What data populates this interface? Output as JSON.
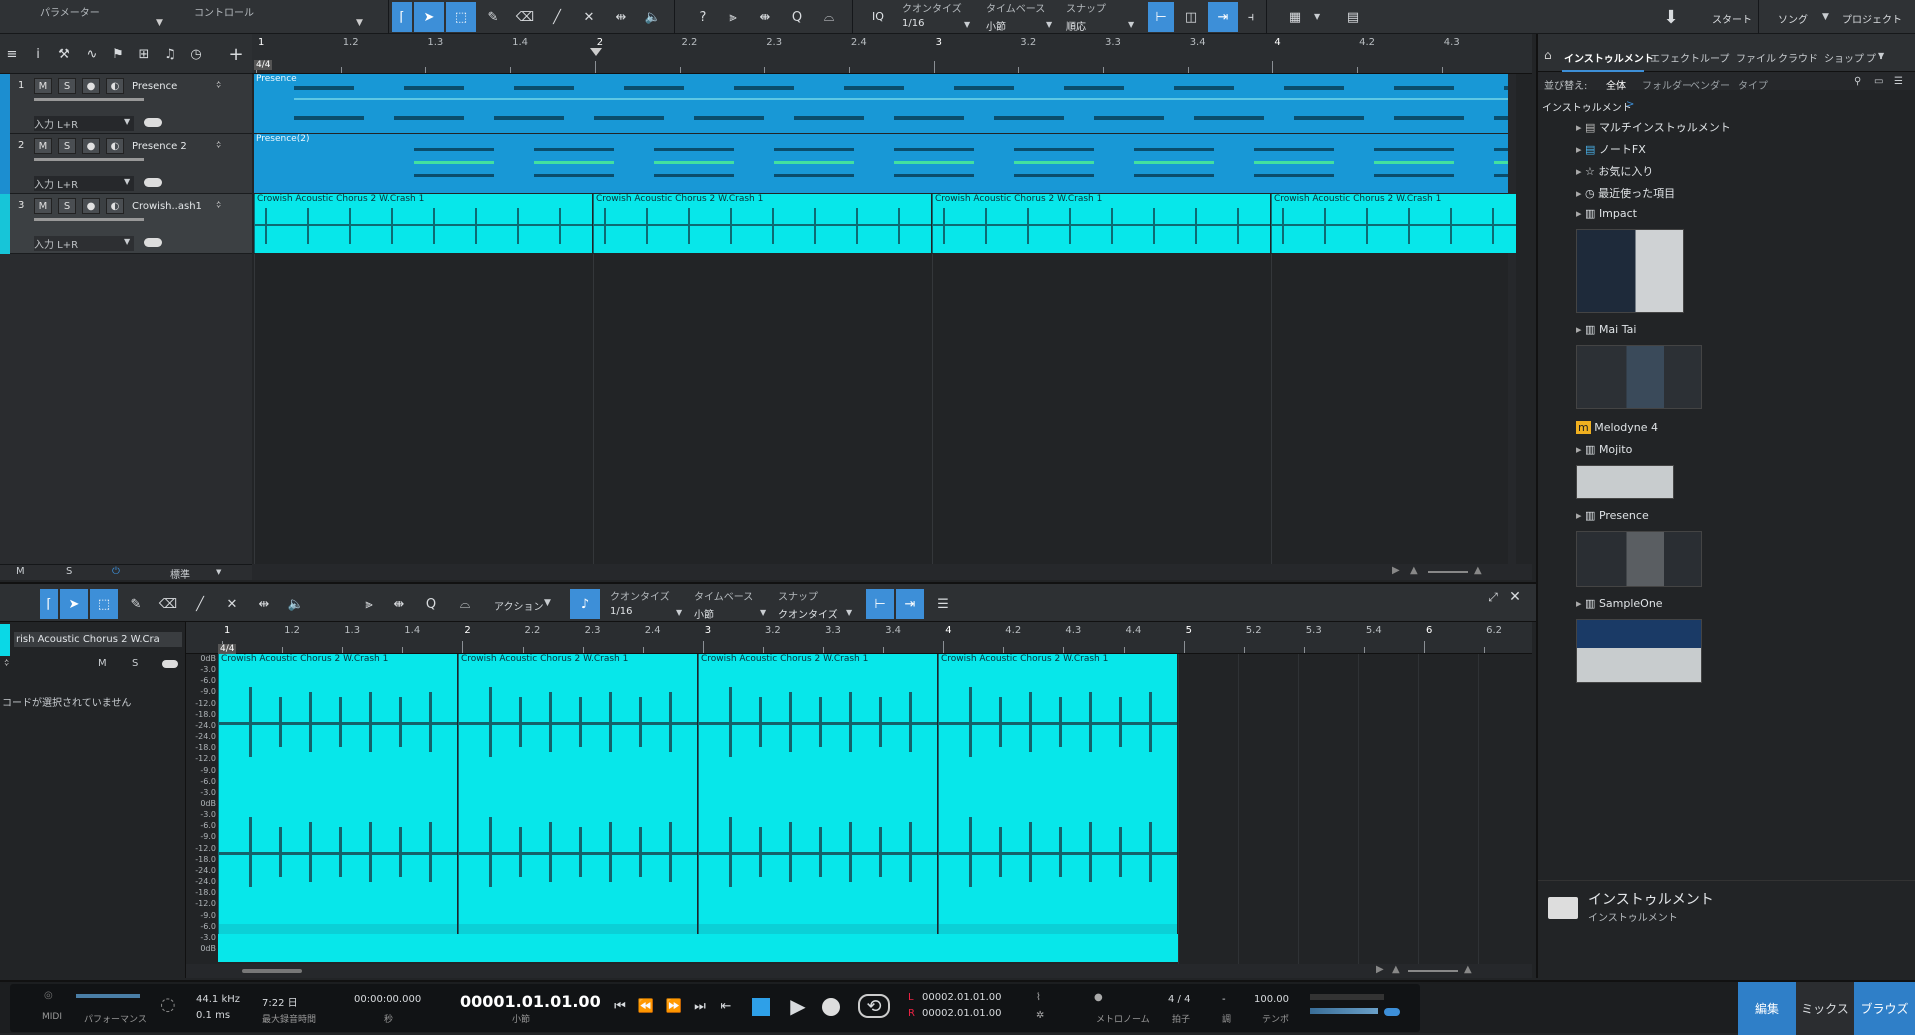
{
  "top_toolbar": {
    "param_label": "パラメーター",
    "control_label": "コントロール",
    "iq_label": "IQ",
    "quantize_label": "クオンタイズ",
    "quantize_value": "1/16",
    "timebase_label": "タイムベース",
    "timebase_value": "小節",
    "snap_label": "スナップ",
    "snap_value": "順応",
    "start_label": "スタート",
    "song_label": "ソング",
    "project_label": "プロジェクト"
  },
  "ruler_marks": [
    "1",
    "1.2",
    "1.3",
    "1.4",
    "2",
    "2.2",
    "2.3",
    "2.4",
    "3",
    "3.2",
    "3.3",
    "3.4",
    "4",
    "4.2",
    "4.3"
  ],
  "time_sig": "4/4",
  "tracks": [
    {
      "num": "1",
      "name": "Presence",
      "input": "入力 L+R",
      "clip": "Presence"
    },
    {
      "num": "2",
      "name": "Presence 2",
      "input": "入力 L+R",
      "clip": "Presence(2)"
    },
    {
      "num": "3",
      "name": "Crowish..ash1",
      "input": "入力 L+R",
      "clip": "Crowish Acoustic Chorus 2 W.Crash 1"
    }
  ],
  "track_buttons": {
    "m": "M",
    "s": "S"
  },
  "tracklist_footer": {
    "m": "M",
    "s": "S",
    "std": "標準"
  },
  "editor_toolbar": {
    "action_label": "アクション",
    "quantize_label": "クオンタイズ",
    "quantize_value": "1/16",
    "timebase_label": "タイムベース",
    "timebase_value": "小節",
    "snap_label": "スナップ",
    "snap_value": "クオンタイズ"
  },
  "editor": {
    "track_name": "rish Acoustic Chorus 2 W.Cra",
    "m": "M",
    "s": "S",
    "no_chord": "コードが選択されていません",
    "ruler_marks": [
      "1",
      "1.2",
      "1.3",
      "1.4",
      "2",
      "2.2",
      "2.3",
      "2.4",
      "3",
      "3.2",
      "3.3",
      "3.4",
      "4",
      "4.2",
      "4.3",
      "4.4",
      "5",
      "5.2",
      "5.3",
      "5.4",
      "6",
      "6.2"
    ],
    "clip_label": "Crowish Acoustic Chorus 2 W.Crash 1",
    "db_labels": [
      "0dB",
      "-3.0",
      "-6.0",
      "-9.0",
      "-12.0",
      "-18.0",
      "-24.0",
      "-24.0",
      "-18.0",
      "-12.0",
      "-9.0",
      "-6.0",
      "-3.0",
      "0dB",
      "-3.0",
      "-6.0",
      "-9.0",
      "-12.0",
      "-18.0",
      "-24.0",
      "-24.0",
      "-18.0",
      "-12.0",
      "-9.0",
      "-6.0",
      "-3.0",
      "0dB"
    ]
  },
  "browser": {
    "tabs": [
      "インストゥルメント",
      "エフェクト",
      "ループ",
      "ファイル",
      "クラウド",
      "ショップ",
      "プ・"
    ],
    "sort_label": "並び替え:",
    "sort_options": [
      "全体",
      "フォルダー",
      "ベンダー",
      "タイプ"
    ],
    "path": "インストゥルメント",
    "items": [
      "マルチインストゥルメント",
      "ノートFX",
      "お気に入り",
      "最近使った項目",
      "Impact",
      "Mai Tai",
      "Melodyne 4",
      "Mojito",
      "Presence",
      "SampleOne"
    ],
    "footer_title": "インストゥルメント",
    "footer_sub": "インストゥルメント"
  },
  "transport": {
    "midi": "MIDI",
    "performance": "パフォーマンス",
    "sample_rate": "44.1 kHz",
    "latency": "0.1 ms",
    "rec_time": "7:22 日",
    "rec_label": "最大録音時間",
    "seconds": "00:00:00.000",
    "seconds_label": "秒",
    "bars": "00001.01.01.00",
    "bars_label": "小節",
    "loop_l": "00002.01.01.00",
    "loop_r": "00002.01.01.00",
    "l": "L",
    "r": "R",
    "metronome_label": "メトロノーム",
    "signature": "4 / 4",
    "signature_label": "拍子",
    "key_dash": "-",
    "key_label": "調",
    "tempo": "100.00",
    "tempo_label": "テンポ",
    "edit": "編集",
    "mix": "ミックス",
    "browse": "ブラウズ"
  }
}
